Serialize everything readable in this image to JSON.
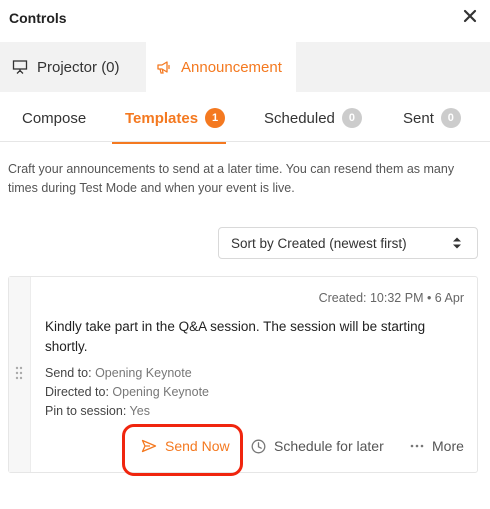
{
  "colors": {
    "accent": "#f47920",
    "highlight": "#f0250e",
    "badge_inactive": "#cccccc"
  },
  "header": {
    "title": "Controls",
    "close_icon": "close-icon"
  },
  "main_tabs": [
    {
      "label": "Projector (0)",
      "icon": "projector-icon"
    },
    {
      "label": "Announcement",
      "icon": "megaphone-icon",
      "active": true
    }
  ],
  "sub_tabs": [
    {
      "label": "Compose"
    },
    {
      "label": "Templates",
      "badge": "1",
      "active": true
    },
    {
      "label": "Scheduled",
      "badge": "0"
    },
    {
      "label": "Sent",
      "badge": "0"
    }
  ],
  "description": "Craft your announcements to send at a later time. You can resend them as many times during Test Mode and when your event is live.",
  "sort": {
    "selected": "Sort by Created (newest first)"
  },
  "card": {
    "created": "Created: 10:32 PM • 6 Apr",
    "message": "Kindly take part in the Q&A session. The session will be starting shortly.",
    "send_to_label": "Send to:",
    "send_to_value": "Opening Keynote",
    "directed_to_label": "Directed to:",
    "directed_to_value": "Opening Keynote",
    "pin_label": "Pin to session:",
    "pin_value": "Yes",
    "actions": {
      "send_now": "Send Now",
      "schedule": "Schedule for later",
      "more": "More"
    }
  }
}
